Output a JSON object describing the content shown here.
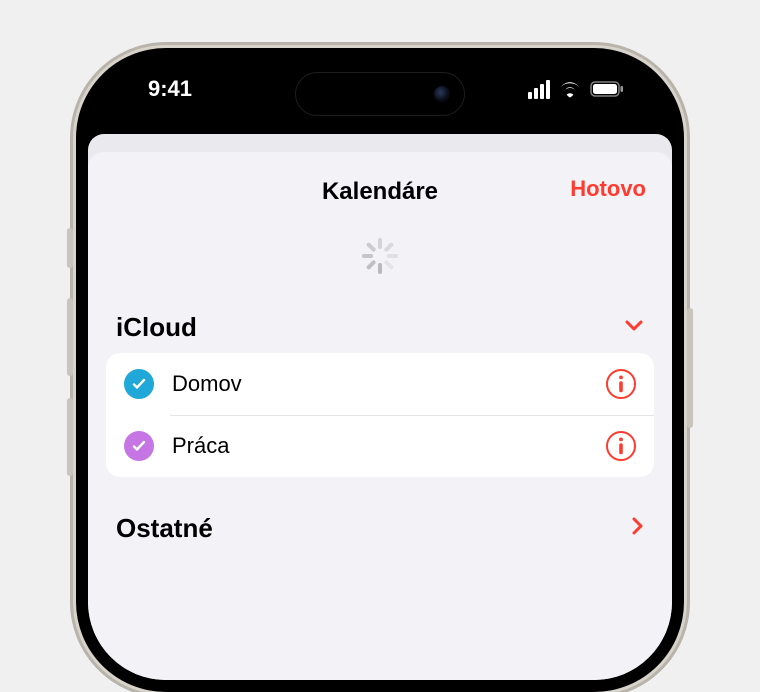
{
  "status": {
    "time": "9:41"
  },
  "sheet": {
    "title": "Kalendáre",
    "done": "Hotovo"
  },
  "sections": {
    "icloud": {
      "title": "iCloud",
      "items": [
        {
          "label": "Domov",
          "color": "#1fa8d8",
          "checked": true
        },
        {
          "label": "Práca",
          "color": "#c675e4",
          "checked": true
        }
      ]
    },
    "other": {
      "title": "Ostatné"
    }
  },
  "colors": {
    "accent": "#ff3b30"
  }
}
